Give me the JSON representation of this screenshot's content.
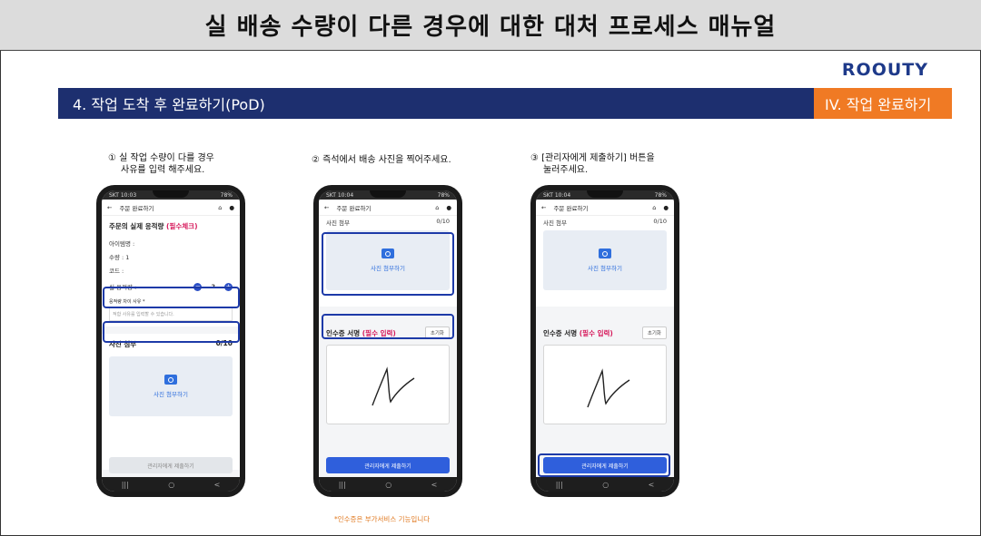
{
  "header": {
    "title": "실 배송 수량이 다른 경우에 대한 대처 프로세스 매뉴얼"
  },
  "brand": {
    "logo_text": "ROOUTY"
  },
  "section": {
    "title": "4. 작업 도착 후 완료하기(PoD)",
    "tag": "IV. 작업 완료하기"
  },
  "steps": [
    {
      "line1": "① 실 작업 수량이 다를 경우",
      "line2": "사유를 입력 해주세요."
    },
    {
      "line1": "② 즉석에서 배송 사진을 찍어주세요."
    },
    {
      "line1": "③ [관리자에게 제출하기] 버튼을",
      "line2": "눌러주세요."
    }
  ],
  "phones": {
    "status_left_1": "SKT 10:03",
    "status_left_2": "SKT 10:04",
    "status_right": "78%",
    "appbar_title": "주문 완료하기",
    "back_icon": "←",
    "qty_section_title": "주문의 실제 응적량",
    "qty_required": "(필수체크)",
    "item_name_label": "아이템명 :",
    "qty_label": "수량 : 1",
    "code_label": "코드 :",
    "actual_qty_label": "실 응적량 :",
    "actual_qty_value": "2",
    "reason_label": "응적량 차이 사유 *",
    "reason_placeholder": "적합 사유를 입력할 수 있습니다.",
    "photo_section": "사진 첨부",
    "photo_count": "0/10",
    "photo_button": "사진 첨부하기",
    "signature_label": "인수증 서명",
    "signature_required": "(필수 입력)",
    "reset_button": "초기화",
    "submit_button": "관리자에게 제출하기",
    "nav_recent": "|||",
    "nav_home": "○",
    "nav_back": "<"
  },
  "footnote": "*인수증은 부가서비스 기능입니다"
}
